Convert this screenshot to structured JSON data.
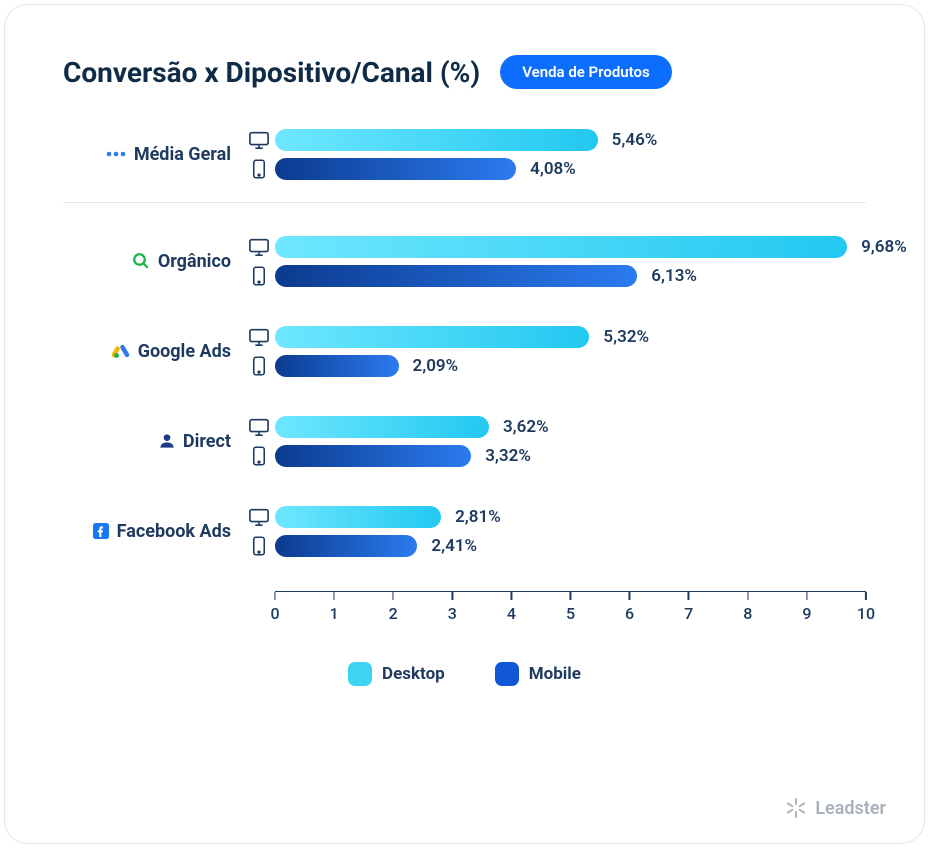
{
  "title": "Conversão x Dipositivo/Canal (%)",
  "pill": "Venda de Produtos",
  "legend": {
    "desktop": "Desktop",
    "mobile": "Mobile"
  },
  "brand": "Leadster",
  "chart_data": {
    "type": "bar",
    "title": "Conversão x Dipositivo/Canal (%)",
    "xlabel": "",
    "ylabel": "",
    "xlim": [
      0,
      10
    ],
    "ticks": [
      0,
      1,
      2,
      3,
      4,
      5,
      6,
      7,
      8,
      9,
      10
    ],
    "categories": [
      "Média Geral",
      "Orgânico",
      "Google Ads",
      "Direct",
      "Facebook Ads"
    ],
    "category_icons": [
      "dots",
      "search",
      "google-ads",
      "user",
      "facebook"
    ],
    "series": [
      {
        "name": "Desktop",
        "values": [
          5.46,
          9.68,
          5.32,
          3.62,
          2.81
        ],
        "display": [
          "5,46%",
          "9,68%",
          "5,32%",
          "3,62%",
          "2,81%"
        ]
      },
      {
        "name": "Mobile",
        "values": [
          4.08,
          6.13,
          2.09,
          3.32,
          2.41
        ],
        "display": [
          "4,08%",
          "6,13%",
          "2,09%",
          "3,32%",
          "2,41%"
        ]
      }
    ],
    "divider_after_index": 0,
    "colors": {
      "desktop": "#3cd4f2",
      "mobile": "#1158d8"
    }
  }
}
